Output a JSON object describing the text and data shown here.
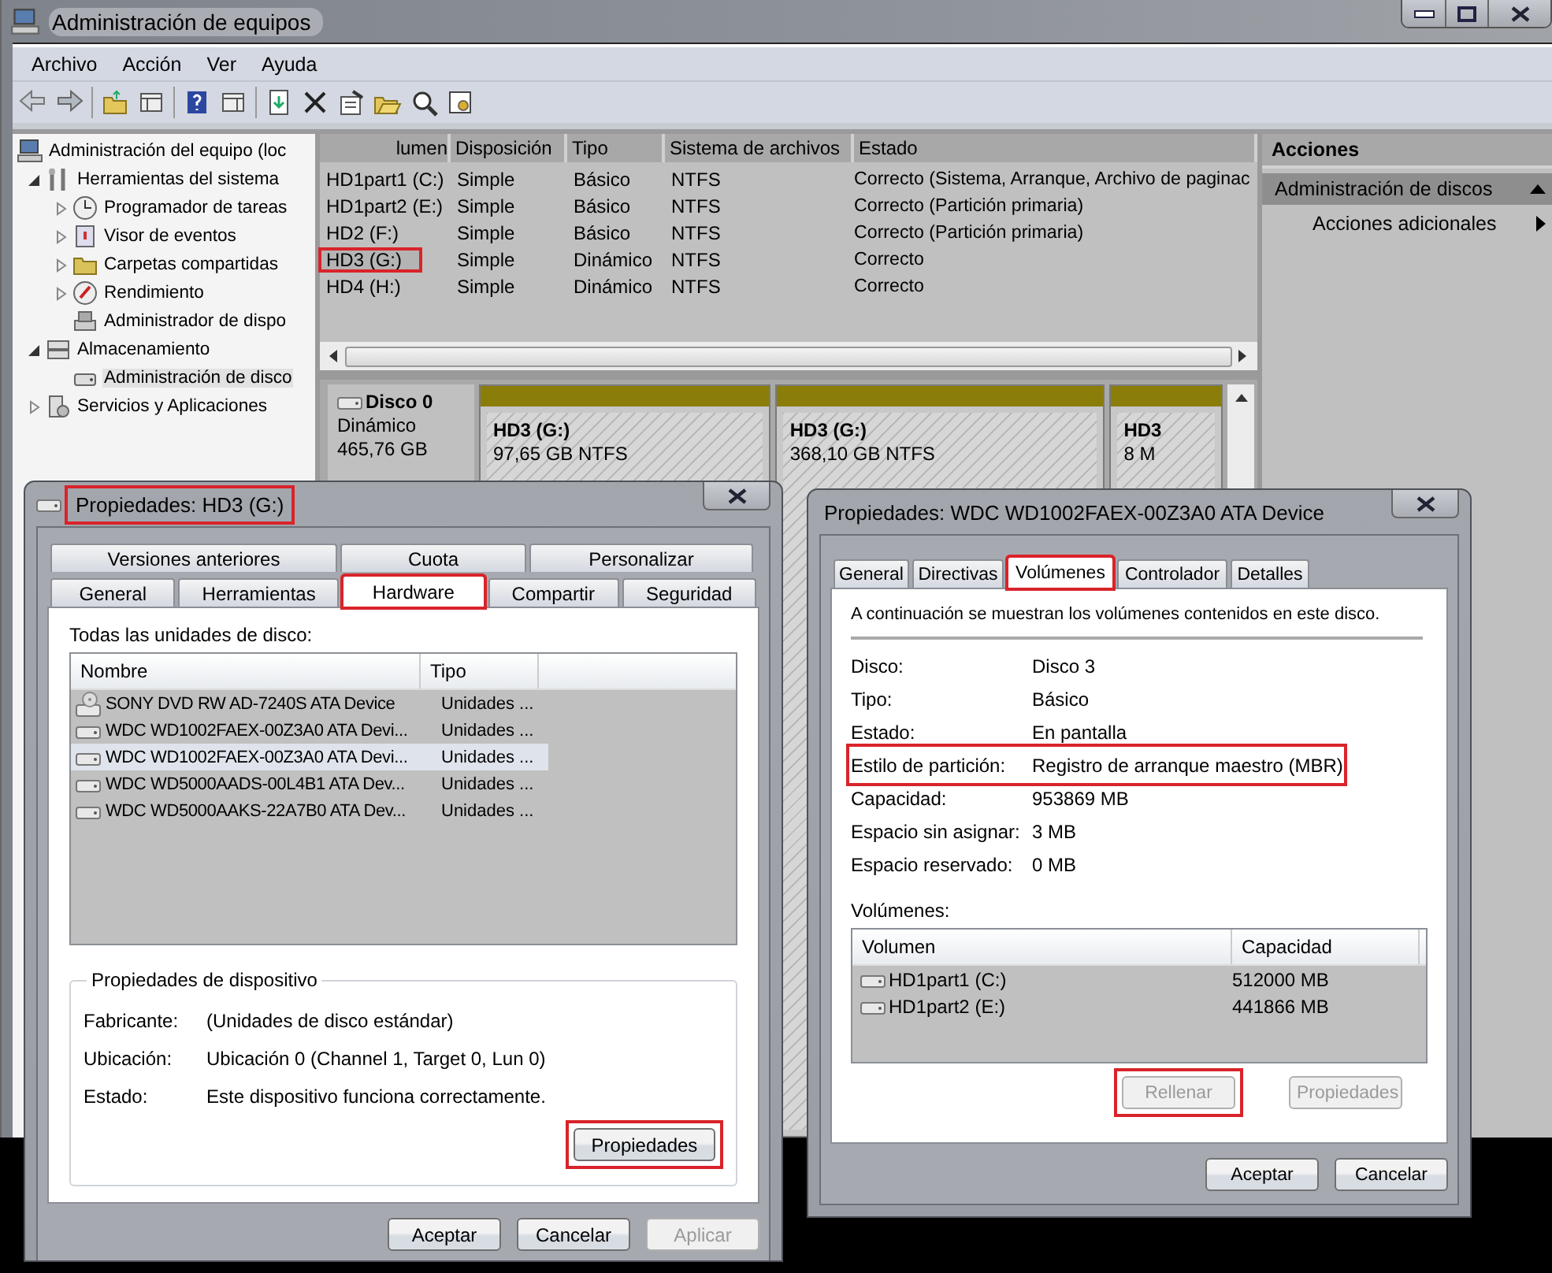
{
  "main_window": {
    "title": "Administración de equipos",
    "menu": [
      "Archivo",
      "Acción",
      "Ver",
      "Ayuda"
    ],
    "tree": [
      {
        "label": "Administración del equipo (loc",
        "kind": "root",
        "selected": false,
        "children": [
          {
            "label": "Herramientas del sistema",
            "kind": "node",
            "expanded": true,
            "selected": false,
            "children": [
              {
                "label": "Programador de tareas",
                "kind": "node",
                "expanded": false,
                "selected": false
              },
              {
                "label": "Visor de eventos",
                "kind": "node",
                "expanded": false,
                "selected": false
              },
              {
                "label": "Carpetas compartidas",
                "kind": "node",
                "expanded": false,
                "selected": false
              },
              {
                "label": "Rendimiento",
                "kind": "node",
                "expanded": false,
                "selected": false
              },
              {
                "label": "Administrador de dispo",
                "kind": "leaf",
                "selected": false
              }
            ]
          },
          {
            "label": "Almacenamiento",
            "kind": "node",
            "expanded": true,
            "selected": false,
            "children": [
              {
                "label": "Administración de disco",
                "kind": "leaf",
                "selected": true
              }
            ]
          },
          {
            "label": "Servicios y Aplicaciones",
            "kind": "node",
            "expanded": false,
            "selected": false
          }
        ]
      }
    ],
    "volumes": {
      "columns": [
        "lumen",
        "Disposición",
        "Tipo",
        "Sistema de archivos",
        "Estado"
      ],
      "rows": [
        {
          "cells": [
            "HD1part1 (C:)",
            "Simple",
            "Básico",
            "NTFS",
            "Correcto (Sistema, Arranque, Archivo de paginac"
          ],
          "highlighted": false
        },
        {
          "cells": [
            "HD1part2 (E:)",
            "Simple",
            "Básico",
            "NTFS",
            "Correcto (Partición primaria)"
          ],
          "highlighted": false
        },
        {
          "cells": [
            "HD2  (F:)",
            "Simple",
            "Básico",
            "NTFS",
            "Correcto (Partición primaria)"
          ],
          "highlighted": false
        },
        {
          "cells": [
            "HD3 (G:)",
            "Simple",
            "Dinámico",
            "NTFS",
            "Correcto"
          ],
          "highlighted": true
        },
        {
          "cells": [
            "HD4 (H:)",
            "Simple",
            "Dinámico",
            "NTFS",
            "Correcto"
          ],
          "highlighted": false
        }
      ]
    },
    "disks": [
      {
        "name": "Disco 0",
        "type": "Dinámico",
        "size": "465,76 GB",
        "partitions": [
          {
            "name": "HD3  (G:)",
            "info": "97,65 GB NTFS"
          },
          {
            "name": "HD3  (G:)",
            "info": "368,10 GB NTFS"
          },
          {
            "name": "HD3",
            "info": "8 M"
          }
        ]
      }
    ],
    "actions": {
      "title": "Acciones",
      "section": "Administración de discos",
      "items": [
        "Acciones adicionales"
      ]
    }
  },
  "hardware_dialog": {
    "title": "Propiedades: HD3 (G:)",
    "title_highlighted": true,
    "tab_rows": [
      [
        {
          "label": "Versiones anteriores",
          "selected": false,
          "highlighted": false
        },
        {
          "label": "Cuota",
          "selected": false,
          "highlighted": false
        },
        {
          "label": "Personalizar",
          "selected": false,
          "highlighted": false
        }
      ],
      [
        {
          "label": "General",
          "selected": false,
          "highlighted": false
        },
        {
          "label": "Herramientas",
          "selected": false,
          "highlighted": false
        },
        {
          "label": "Hardware",
          "selected": true,
          "highlighted": true
        },
        {
          "label": "Compartir",
          "selected": false,
          "highlighted": false
        },
        {
          "label": "Seguridad",
          "selected": false,
          "highlighted": false
        }
      ]
    ],
    "list_label": "Todas las unidades de disco:",
    "columns": [
      "Nombre",
      "Tipo"
    ],
    "devices": [
      {
        "kind": "optical",
        "name": "SONY DVD RW AD-7240S ATA Device",
        "type": "Unidades ...",
        "selected": false
      },
      {
        "kind": "disk",
        "name": "WDC WD1002FAEX-00Z3A0 ATA Devi...",
        "type": "Unidades ...",
        "selected": false
      },
      {
        "kind": "disk",
        "name": "WDC WD1002FAEX-00Z3A0 ATA Devi...",
        "type": "Unidades ...",
        "selected": true
      },
      {
        "kind": "disk",
        "name": "WDC WD5000AADS-00L4B1 ATA Dev...",
        "type": "Unidades ...",
        "selected": false
      },
      {
        "kind": "disk",
        "name": "WDC WD5000AAKS-22A7B0 ATA Dev...",
        "type": "Unidades ...",
        "selected": false
      }
    ],
    "group_title": "Propiedades de dispositivo",
    "properties": [
      {
        "label": "Fabricante:",
        "value": "(Unidades de disco estándar)"
      },
      {
        "label": "Ubicación:",
        "value": "Ubicación 0 (Channel 1, Target 0, Lun 0)"
      },
      {
        "label": "Estado:",
        "value": "Este dispositivo funciona correctamente."
      }
    ],
    "group_button": {
      "label": "Propiedades",
      "highlighted": true
    },
    "buttons": [
      {
        "label": "Aceptar",
        "disabled": false
      },
      {
        "label": "Cancelar",
        "disabled": false
      },
      {
        "label": "Aplicar",
        "disabled": true
      }
    ]
  },
  "device_dialog": {
    "title": "Propiedades: WDC WD1002FAEX-00Z3A0 ATA Device",
    "tabs": [
      {
        "label": "General",
        "selected": false,
        "highlighted": false
      },
      {
        "label": "Directivas",
        "selected": false,
        "highlighted": false
      },
      {
        "label": "Volúmenes",
        "selected": true,
        "highlighted": true
      },
      {
        "label": "Controlador",
        "selected": false,
        "highlighted": false
      },
      {
        "label": "Detalles",
        "selected": false,
        "highlighted": false
      }
    ],
    "intro": "A continuación se muestran los volúmenes contenidos en este disco.",
    "fields": [
      {
        "label": "Disco:",
        "value": "Disco 3",
        "highlighted": false
      },
      {
        "label": "Tipo:",
        "value": "Básico",
        "highlighted": false
      },
      {
        "label": "Estado:",
        "value": "En pantalla",
        "highlighted": false
      },
      {
        "label": "Estilo de partición:",
        "value": "Registro de arranque maestro (MBR)",
        "highlighted": true
      },
      {
        "label": "Capacidad:",
        "value": "953869 MB",
        "highlighted": false
      },
      {
        "label": "Espacio sin asignar:",
        "value": "3 MB",
        "highlighted": false
      },
      {
        "label": "Espacio reservado:",
        "value": "0 MB",
        "highlighted": false
      }
    ],
    "volumes_label": "Volúmenes:",
    "columns": [
      "Volumen",
      "Capacidad"
    ],
    "volumes": [
      {
        "name": "HD1part1 (C:)",
        "capacity": "512000 MB"
      },
      {
        "name": "HD1part2 (E:)",
        "capacity": "441866 MB"
      }
    ],
    "action_buttons": [
      {
        "label": "Rellenar",
        "disabled": true,
        "highlighted": true
      },
      {
        "label": "Propiedades",
        "disabled": true,
        "highlighted": false
      }
    ],
    "buttons": [
      {
        "label": "Aceptar",
        "disabled": false
      },
      {
        "label": "Cancelar",
        "disabled": false
      }
    ]
  }
}
